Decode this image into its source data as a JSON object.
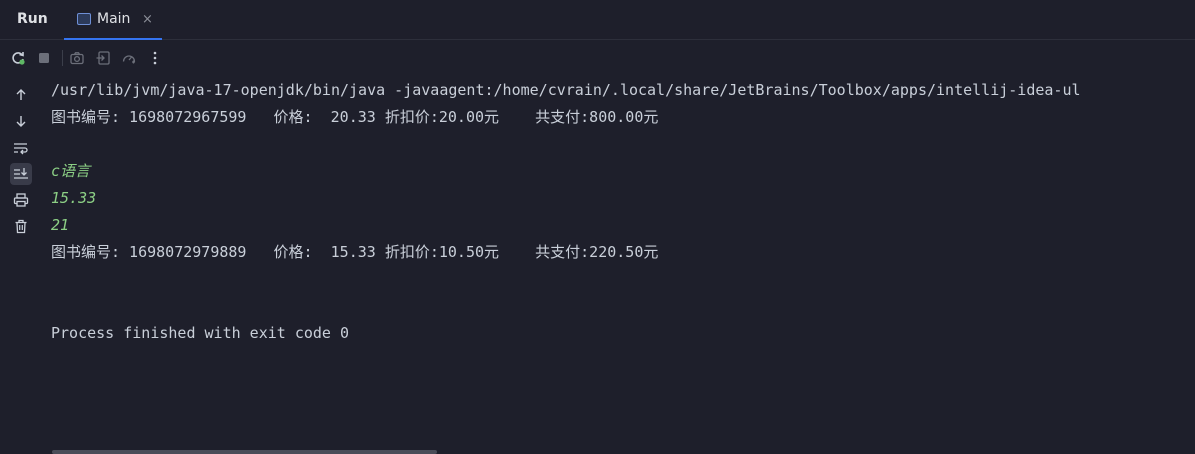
{
  "header": {
    "run_title": "Run",
    "tab_label": "Main",
    "tab_close": "×"
  },
  "toolbar": {
    "icons": [
      "rerun-icon",
      "stop-icon",
      "camera-icon",
      "export-icon",
      "dashboard-icon",
      "more-icon"
    ]
  },
  "gutter": {
    "icons": [
      "arrow-up-icon",
      "arrow-down-icon",
      "soft-wrap-icon",
      "scroll-to-end-icon",
      "print-icon",
      "trash-icon"
    ]
  },
  "console": {
    "lines": [
      {
        "text": "/usr/lib/jvm/java-17-openjdk/bin/java -javaagent:/home/cvrain/.local/share/JetBrains/Toolbox/apps/intellij-idea-ul",
        "style": "normal"
      },
      {
        "text": "图书编号: 1698072967599   价格:  20.33 折扣价:20.00元    共支付:800.00元",
        "style": "normal"
      },
      {
        "text": "",
        "style": "normal"
      },
      {
        "text": "c语言",
        "style": "green"
      },
      {
        "text": "15.33",
        "style": "green"
      },
      {
        "text": "21",
        "style": "green"
      },
      {
        "text": "图书编号: 1698072979889   价格:  15.33 折扣价:10.50元    共支付:220.50元",
        "style": "normal"
      },
      {
        "text": "",
        "style": "normal"
      },
      {
        "text": "",
        "style": "normal"
      },
      {
        "text": "Process finished with exit code 0",
        "style": "normal"
      }
    ]
  },
  "colors": {
    "background": "#1e1f2b",
    "text": "#c9cfd9",
    "input_echo": "#8ccf85",
    "tab_underline": "#3574f0"
  }
}
